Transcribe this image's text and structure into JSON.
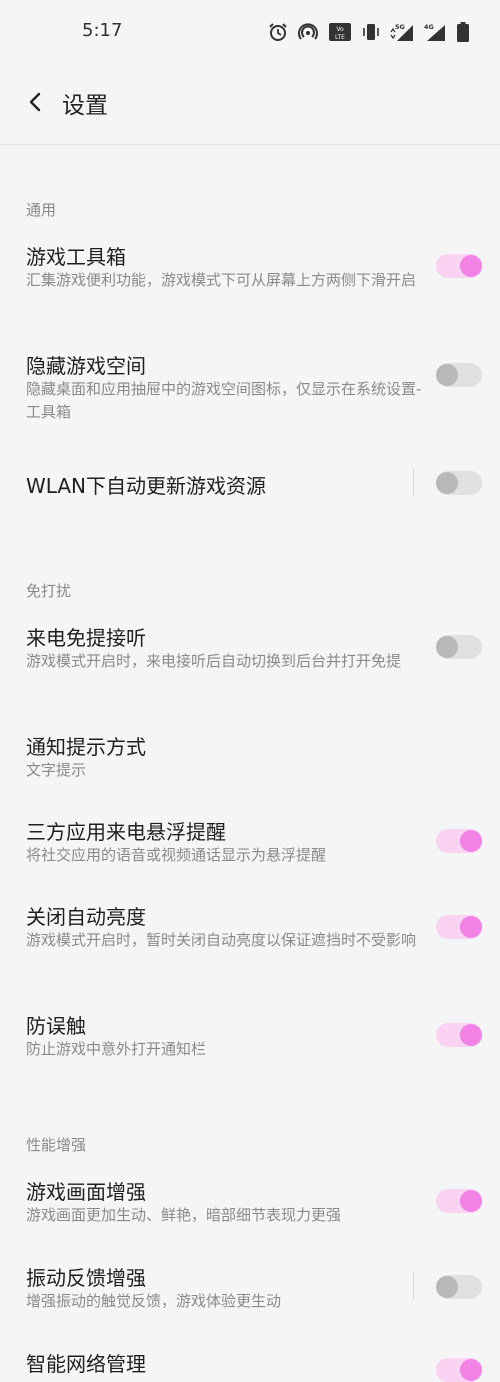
{
  "status": {
    "time": "5:17",
    "icons": [
      "alarm-icon",
      "hotspot-icon",
      "volte-icon",
      "vibrate-icon",
      "signal-5g-icon",
      "signal-4g-icon",
      "battery-icon"
    ],
    "lte_badge": "Vo LTE 2",
    "net5g": "5G",
    "net4g": "4G"
  },
  "header": {
    "title": "设置"
  },
  "colors": {
    "accent": "#f282e5",
    "accent_track": "#fad3f3",
    "off_knob": "#b8b8b8",
    "off_track": "#e0e0e0"
  },
  "sections": {
    "general": "通用",
    "dnd": "免打扰",
    "perf": "性能增强"
  },
  "items": {
    "toolbox": {
      "title": "游戏工具箱",
      "subtitle": "汇集游戏便利功能，游戏模式下可从屏幕上方两侧下滑开启",
      "on": true
    },
    "hide_space": {
      "title": "隐藏游戏空间",
      "subtitle": "隐藏桌面和应用抽屉中的游戏空间图标，仅显示在系统设置-工具箱",
      "on": false
    },
    "wlan_update": {
      "title": "WLAN下自动更新游戏资源",
      "on": false
    },
    "hands_free": {
      "title": "来电免提接听",
      "subtitle": "游戏模式开启时，来电接听后自动切换到后台并打开免提",
      "on": false
    },
    "notify_mode": {
      "title": "通知提示方式",
      "subtitle": "文字提示"
    },
    "third_party_call": {
      "title": "三方应用来电悬浮提醒",
      "subtitle": "将社交应用的语音或视频通话显示为悬浮提醒",
      "on": true
    },
    "auto_brightness": {
      "title": "关闭自动亮度",
      "subtitle": "游戏模式开启时，暂时关闭自动亮度以保证遮挡时不受影响",
      "on": true
    },
    "anti_touch": {
      "title": "防误触",
      "subtitle": "防止游戏中意外打开通知栏",
      "on": true
    },
    "picture_enhance": {
      "title": "游戏画面增强",
      "subtitle": "游戏画面更加生动、鲜艳，暗部细节表现力更强",
      "on": true
    },
    "vibration_enhance": {
      "title": "振动反馈增强",
      "subtitle": "增强振动的触觉反馈，游戏体验更生动",
      "on": false
    },
    "network_manage": {
      "title": "智能网络管理",
      "on": true
    }
  }
}
